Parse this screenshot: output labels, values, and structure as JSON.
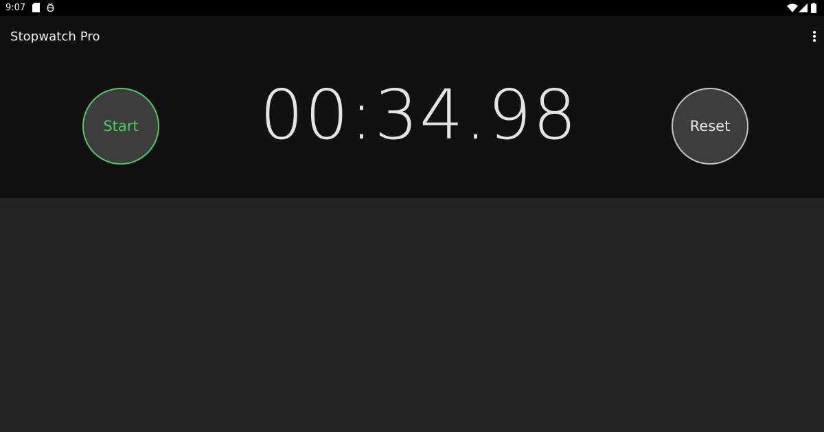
{
  "status_bar": {
    "time": "9:07",
    "left_icons": [
      "sd-card-icon",
      "debug-icon"
    ],
    "right_icons": [
      "wifi-icon",
      "signal-icon",
      "battery-icon"
    ]
  },
  "app_bar": {
    "title": "Stopwatch Pro",
    "menu_icon": "more-vert-icon"
  },
  "stopwatch": {
    "time": "00:34.98",
    "start_label": "Start",
    "reset_label": "Reset"
  },
  "colors": {
    "start_accent": "#4ccb5e",
    "reset_border": "#c4c4c4",
    "header_bg": "#111111",
    "content_bg": "#222222"
  }
}
